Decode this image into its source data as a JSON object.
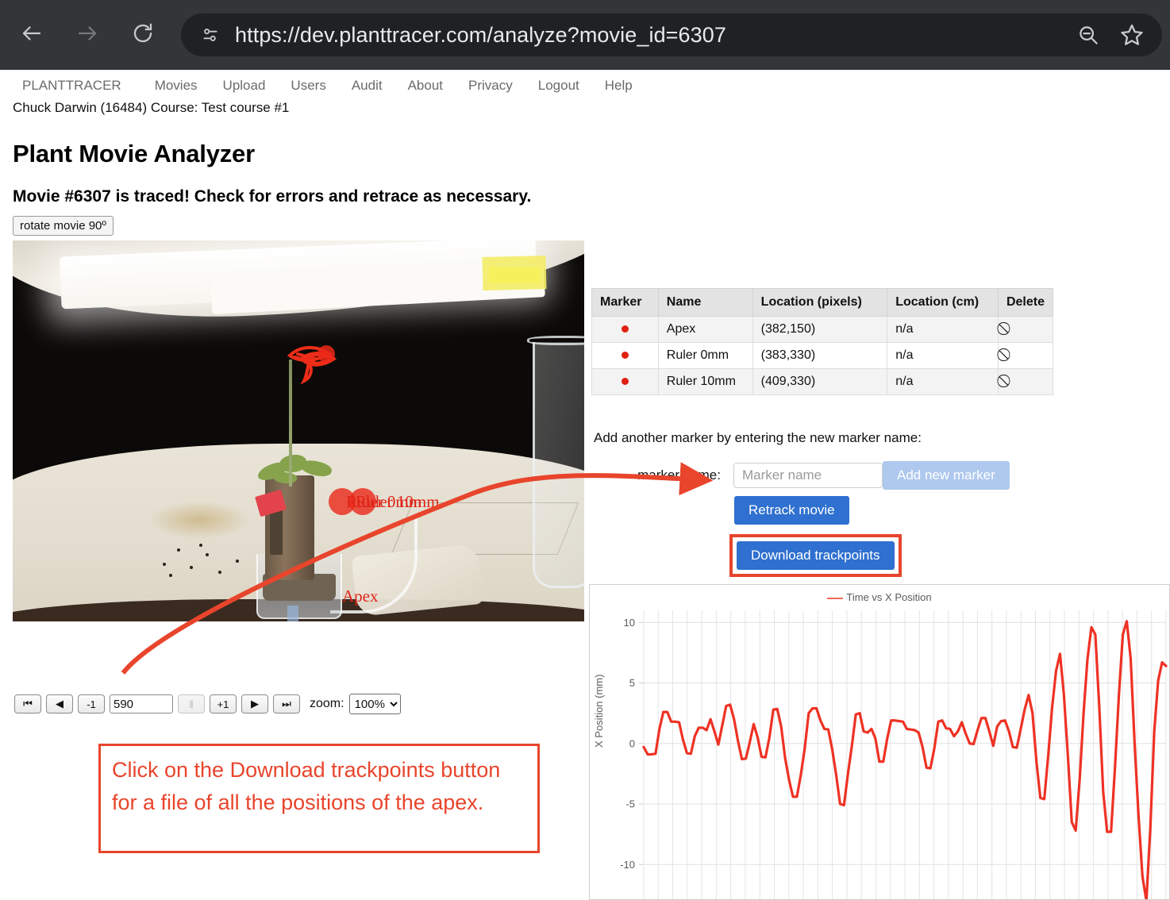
{
  "browser": {
    "url": "https://dev.planttracer.com/analyze?movie_id=6307",
    "back_icon": "back-arrow-icon",
    "forward_icon": "forward-arrow-icon",
    "reload_icon": "reload-icon",
    "site_info_icon": "site-settings-icon",
    "zoom_out_icon": "zoom-out-icon",
    "bookmark_icon": "star-icon"
  },
  "nav": {
    "items": [
      {
        "label": "PLANTTRACER"
      },
      {
        "label": "Movies"
      },
      {
        "label": "Upload"
      },
      {
        "label": "Users"
      },
      {
        "label": "Audit"
      },
      {
        "label": "About"
      },
      {
        "label": "Privacy"
      },
      {
        "label": "Logout"
      },
      {
        "label": "Help"
      }
    ],
    "user_line": "Chuck Darwin (16484) Course: Test course #1"
  },
  "page": {
    "title": "Plant Movie Analyzer",
    "subtitle": "Movie #6307 is traced! Check for errors and retrace as necessary."
  },
  "movie": {
    "rotate_label": "rotate movie 90º",
    "overlay_labels": [
      {
        "text": "Apex"
      },
      {
        "text": "Ruler 0mm"
      },
      {
        "text": "Ruler 10mm"
      }
    ]
  },
  "controls": {
    "first_frame": "⏮",
    "prev_play": "◀",
    "minus_one": "-1",
    "frame_value": "590",
    "pause": "‖",
    "plus_one": "+1",
    "play": "▶",
    "last_frame": "⏭",
    "zoom_label": "zoom:",
    "zoom_value": "100%",
    "zoom_options": [
      "100%"
    ]
  },
  "callout": {
    "text": "Click on the Download trackpoints button for a file of all the positions of the apex.",
    "border_color": "#e8452c"
  },
  "marker_table": {
    "headers": [
      "Marker",
      "Name",
      "Location (pixels)",
      "Location (cm)",
      "Delete"
    ],
    "rows": [
      {
        "marker": "●",
        "name": "Apex",
        "location_px": "(382,150)",
        "location_cm": "n/a",
        "delete": "⃠"
      },
      {
        "marker": "●",
        "name": "Ruler 0mm",
        "location_px": "(383,330)",
        "location_cm": "n/a",
        "delete": "⃠"
      },
      {
        "marker": "●",
        "name": "Ruler 10mm",
        "location_px": "(409,330)",
        "location_cm": "n/a",
        "delete": "⃠"
      }
    ]
  },
  "form": {
    "instruction": "Add another marker by entering the new marker name:",
    "marker_name_label": "marker name:",
    "marker_name_placeholder": "Marker name",
    "marker_name_value": "",
    "add_marker_label": "Add new marker",
    "retrack_label": "Retrack movie",
    "download_label": "Download trackpoints",
    "accent_blue": "#2f70d0",
    "disabled_blue": "#aec8ee"
  },
  "chart_data": {
    "type": "line",
    "title": "",
    "legend": [
      "Time vs X Position"
    ],
    "legend_position": "top-center",
    "xlabel": "",
    "ylabel": "X Position (mm)",
    "ylim": [
      -13,
      11
    ],
    "yticks": [
      10,
      5,
      0,
      -5,
      -10
    ],
    "grid": true,
    "line_color": "#ee3224",
    "series": [
      {
        "name": "Time vs X Position",
        "values": [
          -0.3,
          -0.9,
          -0.9,
          -0.85,
          1.2,
          2.6,
          2.6,
          1.8,
          1.8,
          1.75,
          0.3,
          -0.8,
          -0.85,
          0.6,
          1.3,
          1.3,
          1.1,
          2.0,
          1.0,
          -0.1,
          1.5,
          3.1,
          3.2,
          2.0,
          0.2,
          -1.3,
          -1.25,
          0.1,
          1.6,
          0.5,
          -1.1,
          -1.15,
          0.5,
          2.8,
          2.85,
          1.4,
          -1.2,
          -3.0,
          -4.4,
          -4.4,
          -2.6,
          -0.4,
          2.5,
          2.9,
          2.9,
          1.9,
          1.2,
          1.15,
          -0.5,
          -2.6,
          -5.0,
          -5.1,
          -2.5,
          -0.2,
          2.4,
          2.5,
          1.0,
          0.9,
          1.2,
          0.4,
          -1.5,
          -1.5,
          0.4,
          1.9,
          1.9,
          1.85,
          1.8,
          1.2,
          1.15,
          1.1,
          0.9,
          -0.3,
          -2.0,
          -2.05,
          -0.4,
          1.8,
          1.9,
          1.25,
          1.2,
          0.6,
          1.0,
          1.75,
          0.8,
          0.0,
          -0.05,
          1.1,
          2.1,
          2.1,
          1.0,
          -0.2,
          1.4,
          1.85,
          1.9,
          1.0,
          -0.3,
          -0.35,
          1.2,
          2.8,
          4.0,
          2.5,
          -1.5,
          -4.5,
          -4.6,
          -1.0,
          3.0,
          6.0,
          7.4,
          4.0,
          -1.0,
          -6.5,
          -7.2,
          -3.0,
          2.5,
          7.0,
          9.6,
          9.0,
          3.0,
          -4.0,
          -7.3,
          -7.3,
          -2.0,
          4.0,
          9.0,
          10.1,
          7.0,
          0.0,
          -6.0,
          -11.0,
          -13.0,
          -7.0,
          1.0,
          5.2,
          6.7,
          6.4
        ]
      }
    ]
  }
}
